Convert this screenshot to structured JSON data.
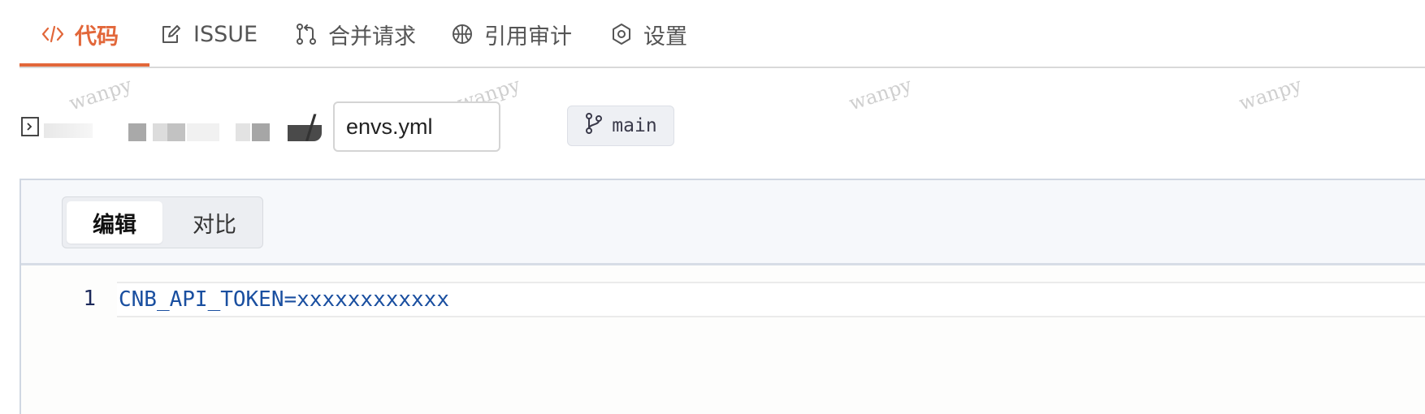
{
  "tabs": [
    {
      "label": "代码",
      "icon": "code-icon",
      "active": true
    },
    {
      "label": "ISSUE",
      "icon": "edit-icon",
      "active": false
    },
    {
      "label": "合并请求",
      "icon": "pull-request-icon",
      "active": false
    },
    {
      "label": "引用审计",
      "icon": "basketball-icon",
      "active": false
    },
    {
      "label": "设置",
      "icon": "gear-icon",
      "active": false
    }
  ],
  "colors": {
    "accent": "#e2673a",
    "code_text": "#1a4fa0"
  },
  "path": {
    "separator": "/",
    "filename_value": "envs.yml"
  },
  "branch": {
    "label": "main",
    "icon": "git-branch-icon"
  },
  "editor": {
    "modes": [
      "编辑",
      "对比"
    ],
    "active_mode": "编辑",
    "lines": [
      {
        "number": "1",
        "text": "CNB_API_TOKEN=xxxxxxxxxxxx"
      }
    ]
  },
  "watermark": "wanpy"
}
